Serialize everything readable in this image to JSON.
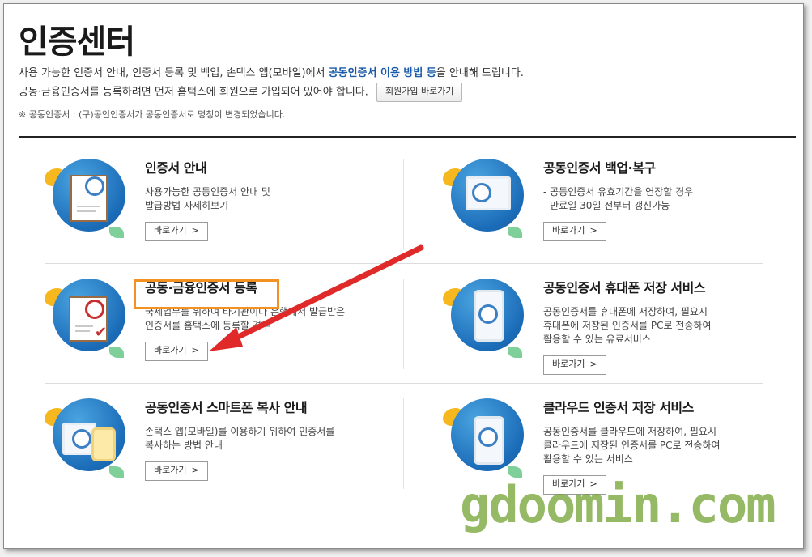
{
  "page": {
    "title": "인증센터",
    "intro_line1_pre": "사용 가능한 인증서 안내, 인증서 등록 및 백업, 손택스 앱(모바일)에서 ",
    "intro_line1_bold": "공동인증서 이용 방법 등",
    "intro_line1_post": "을 안내해 드립니다.",
    "intro_line2": "공동·금융인증서를 등록하려면 먼저 홈택스에 회원으로 가입되어 있어야 합니다.",
    "join_button": "회원가입 바로가기",
    "note": "※ 공동인증서 : (구)공인인증서가 공동인증서로 명칭이 변경되었습니다."
  },
  "cards": [
    {
      "title": "인증서 안내",
      "desc": [
        "사용가능한 공동인증서 안내 및",
        "발급방법 자세히보기"
      ],
      "button": "바로가기",
      "icon": "certificate-document-icon"
    },
    {
      "title": "공동인증서 백업·복구",
      "desc": [
        "- 공동인증서 유효기간을 연장할 경우",
        "- 만료일 30일 전부터 갱신가능"
      ],
      "button": "바로가기",
      "icon": "monitor-certificate-icon"
    },
    {
      "title": "공동·금융인증서 등록",
      "desc": [
        "국세업무를 위하여 타기관이나 은행에서 발급받은",
        "인증서를 홈택스에 등록할 경우"
      ],
      "button": "바로가기",
      "icon": "certificate-register-icon"
    },
    {
      "title": "공동인증서 휴대폰 저장 서비스",
      "desc": [
        "공동인증서를 휴대폰에 저장하여, 필요시",
        "휴대폰에 저장된 인증서를 PC로 전송하여",
        "활용할 수 있는 유료서비스"
      ],
      "button": "바로가기",
      "icon": "phone-certificate-icon"
    },
    {
      "title": "공동인증서 스마트폰 복사 안내",
      "desc": [
        "손택스 앱(모바일)를 이용하기 위하여 인증서를",
        "복사하는 방법 안내"
      ],
      "button": "바로가기",
      "icon": "smartphone-copy-icon"
    },
    {
      "title": "클라우드 인증서 저장 서비스",
      "desc": [
        "공동인증서를 클라우드에 저장하여, 필요시",
        "클라우드에 저장된 인증서를 PC로 전송하여",
        "활용할 수 있는 서비스"
      ],
      "button": "바로가기",
      "icon": "cloud-certificate-icon"
    }
  ],
  "annotations": {
    "watermark": "gdoomin.com",
    "highlight_color": "#f39222",
    "arrow_color": "#e02a2a"
  },
  "colors": {
    "accent_blue": "#1a5aa8",
    "icon_circle": "#1b6cb8"
  }
}
